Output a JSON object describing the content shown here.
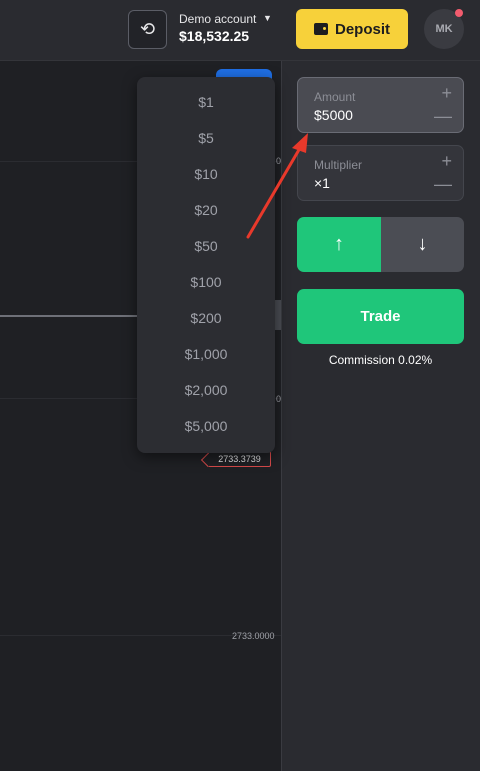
{
  "header": {
    "account_name": "Demo account",
    "account_caret": "▼",
    "balance": "$18,532.25",
    "deposit_label": "Deposit",
    "avatar_initials": "MK",
    "switch_icon": "refresh-icon"
  },
  "chart": {
    "axis_labels": [
      "0",
      "0",
      "2733.0000"
    ],
    "current_price": "2733.3739"
  },
  "trade_panel": {
    "amount_label": "Amount",
    "amount_value": "$5000",
    "multiplier_label": "Multiplier",
    "multiplier_value": "×1",
    "plus": "+",
    "minus": "—",
    "up_icon": "↑",
    "down_icon": "↓",
    "trade_label": "Trade",
    "commission": "Commission 0.02%"
  },
  "amount_dropdown": {
    "options": [
      "$1",
      "$5",
      "$10",
      "$20",
      "$50",
      "$100",
      "$200",
      "$1,000",
      "$2,000",
      "$5,000"
    ]
  },
  "colors": {
    "accent_green": "#1fc67a",
    "deposit_yellow": "#f7d13a",
    "annotation_red": "#e8392b"
  }
}
